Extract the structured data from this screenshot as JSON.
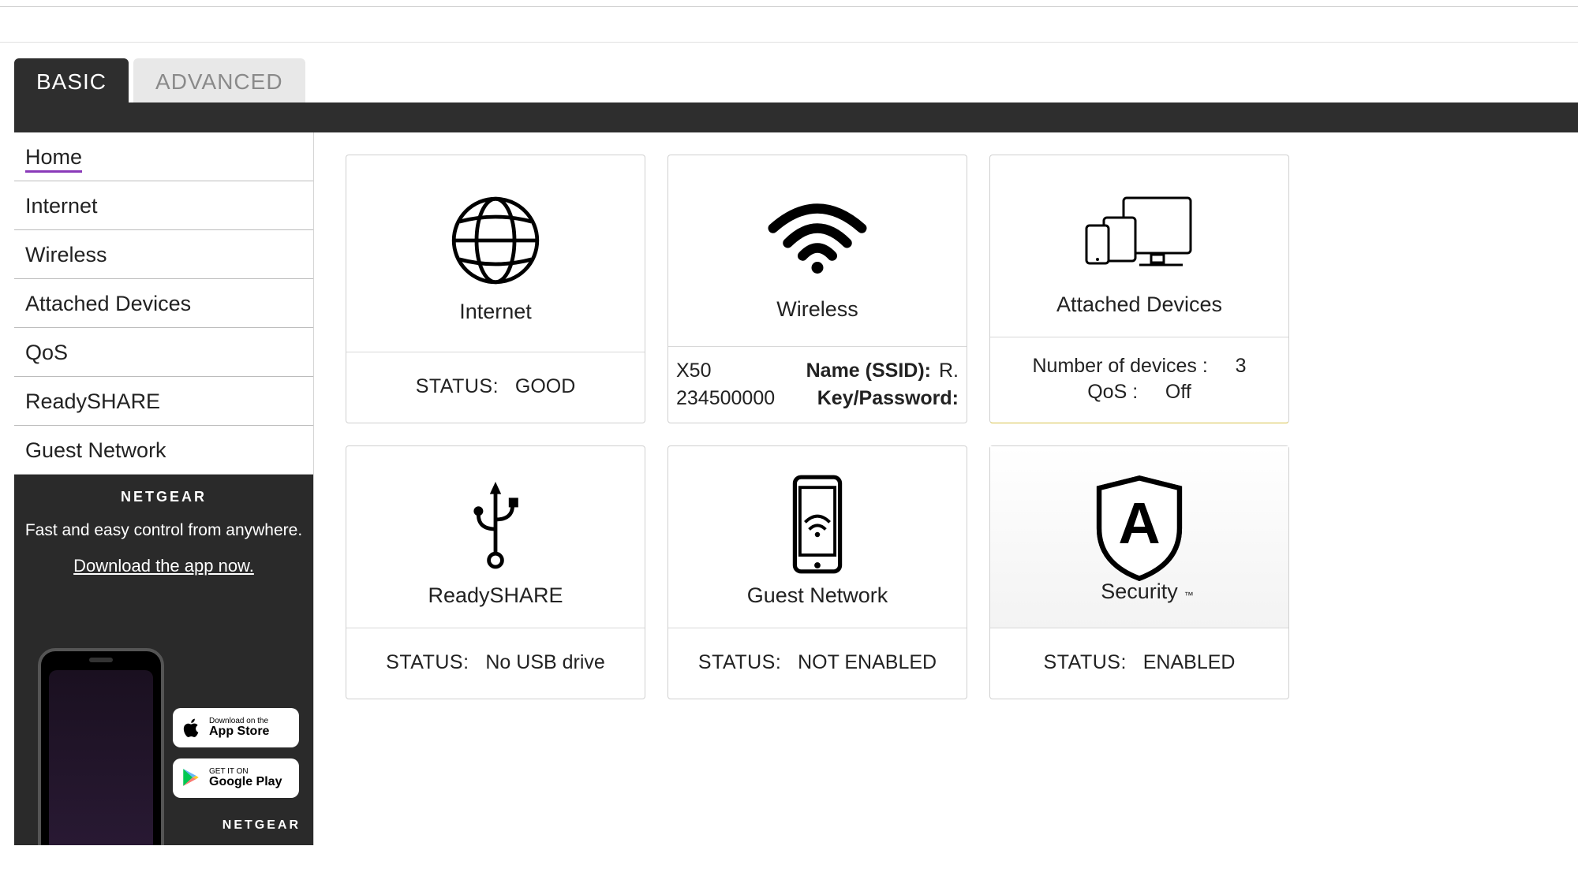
{
  "tabs": {
    "basic": "BASIC",
    "advanced": "ADVANCED"
  },
  "sidebar": {
    "items": [
      {
        "label": "Home"
      },
      {
        "label": "Internet"
      },
      {
        "label": "Wireless"
      },
      {
        "label": "Attached Devices"
      },
      {
        "label": "QoS"
      },
      {
        "label": "ReadySHARE"
      },
      {
        "label": "Guest Network"
      }
    ]
  },
  "promo": {
    "brand": "NETGEAR",
    "sub": "Fast and easy control from anywhere.",
    "link": "Download the app now.",
    "appstore_small": "Download on the",
    "appstore_big": "App Store",
    "play_small": "GET IT ON",
    "play_big": "Google Play",
    "footer": "NETGEAR"
  },
  "cards": {
    "internet": {
      "title": "Internet",
      "status_label": "STATUS:",
      "status_value": "GOOD"
    },
    "wireless": {
      "title": "Wireless",
      "linea_left": "X50",
      "linea_label": "Name (SSID):",
      "linea_right": "R.",
      "lineb_left": "234500000",
      "lineb_label": "Key/Password:"
    },
    "attached": {
      "title": "Attached Devices",
      "count_label": "Number of devices :",
      "count_value": "3",
      "qos_label": "QoS :",
      "qos_value": "Off"
    },
    "readyshare": {
      "title": "ReadySHARE",
      "status_label": "STATUS:",
      "status_value": "No USB drive"
    },
    "guest": {
      "title": "Guest Network",
      "status_label": "STATUS:",
      "status_value": "NOT ENABLED"
    },
    "security": {
      "title": "Security",
      "status_label": "STATUS:",
      "status_value": "ENABLED"
    }
  }
}
